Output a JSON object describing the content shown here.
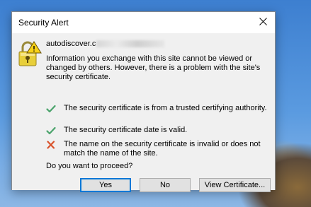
{
  "dialog": {
    "title": "Security Alert",
    "close_glyph": "✕",
    "host": "autodiscover.c",
    "info": "Information you exchange with this site cannot be viewed or changed by others. However, there is a problem with the site's security certificate.",
    "checks": [
      {
        "status": "pass",
        "icon": "checkmark-icon",
        "text": "The security certificate is from a trusted certifying authority."
      },
      {
        "status": "pass",
        "icon": "checkmark-icon",
        "text": "The security certificate date is valid."
      },
      {
        "status": "fail",
        "icon": "x-mark-icon",
        "text": "The name on the security certificate is invalid or does not match the name of the site."
      }
    ],
    "question": "Do you want to proceed?",
    "buttons": {
      "yes": "Yes",
      "no": "No",
      "view_certificate": "View Certificate..."
    }
  },
  "colors": {
    "pass": "#4aa36b",
    "fail": "#d9532c",
    "default_button_border": "#0078d7",
    "dialog_body": "#f0f0f0"
  }
}
